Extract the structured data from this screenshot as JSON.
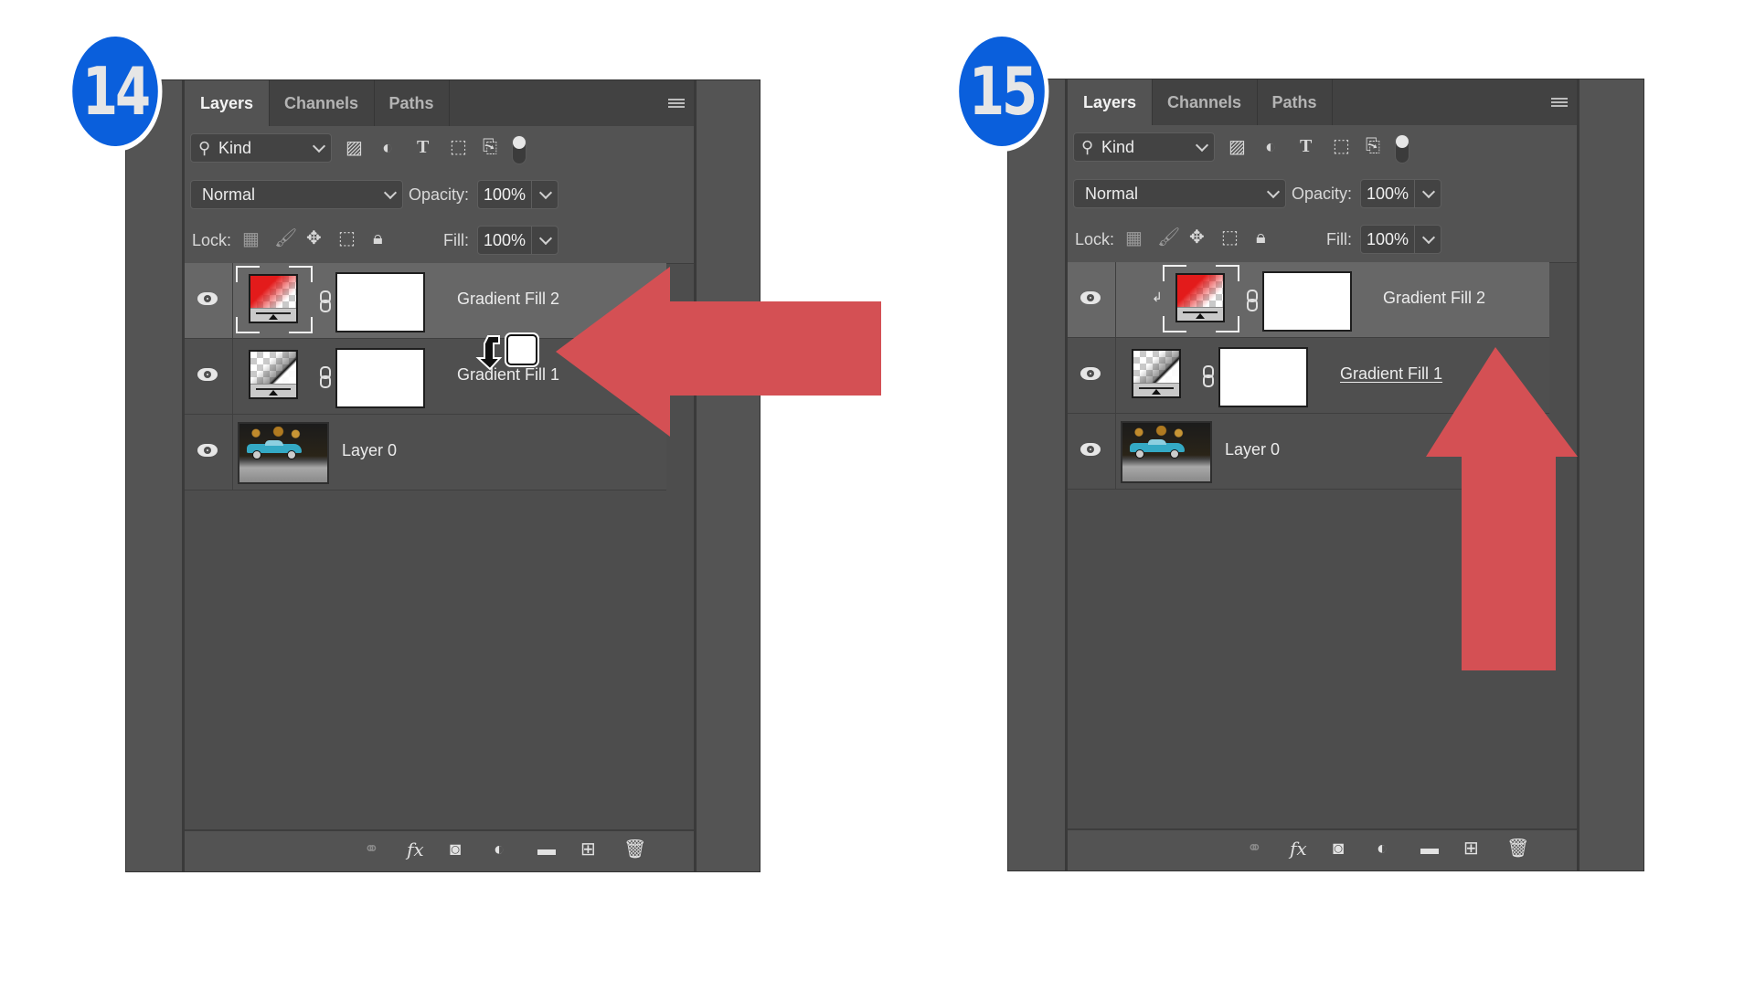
{
  "steps": [
    {
      "number": "14",
      "panel": {
        "tabs": [
          {
            "label": "Layers",
            "active": true
          },
          {
            "label": "Channels",
            "active": false
          },
          {
            "label": "Paths",
            "active": false
          }
        ],
        "filter": {
          "value": "Kind",
          "icons": [
            "image-filter-icon",
            "adjustment-filter-icon",
            "type-filter-icon",
            "shape-filter-icon",
            "smart-object-filter-icon",
            "filter-toggle"
          ]
        },
        "blend_mode": "Normal",
        "opacity_label": "Opacity:",
        "opacity_value": "100%",
        "lock_label": "Lock:",
        "fill_label": "Fill:",
        "fill_value": "100%",
        "layers": [
          {
            "name": "Gradient Fill 2",
            "type": "gradient",
            "thumb": "red",
            "selected": true,
            "clipped": false,
            "visible": true
          },
          {
            "name": "Gradient Fill 1",
            "type": "gradient",
            "thumb": "bw",
            "selected": false,
            "clipped": false,
            "visible": true,
            "underlined": false
          },
          {
            "name": "Layer 0",
            "type": "photo",
            "selected": false,
            "visible": true
          }
        ],
        "footer_icons": [
          "link-layers-icon",
          "fx-icon",
          "add-mask-icon",
          "adjustment-layer-icon",
          "group-folder-icon",
          "new-layer-icon",
          "trash-icon"
        ]
      },
      "annotation": {
        "type": "arrow-left",
        "color": "#d45054",
        "cursor": "clip-drag-cursor"
      }
    },
    {
      "number": "15",
      "panel": {
        "tabs": [
          {
            "label": "Layers",
            "active": true
          },
          {
            "label": "Channels",
            "active": false
          },
          {
            "label": "Paths",
            "active": false
          }
        ],
        "filter": {
          "value": "Kind"
        },
        "blend_mode": "Normal",
        "opacity_label": "Opacity:",
        "opacity_value": "100%",
        "lock_label": "Lock:",
        "fill_label": "Fill:",
        "fill_value": "100%",
        "layers": [
          {
            "name": "Gradient Fill 2",
            "type": "gradient",
            "thumb": "red",
            "selected": true,
            "clipped": true,
            "visible": true
          },
          {
            "name": "Gradient Fill 1",
            "type": "gradient",
            "thumb": "bw",
            "selected": false,
            "clipped": false,
            "visible": true,
            "underlined": true
          },
          {
            "name": "Layer 0",
            "type": "photo",
            "selected": false,
            "visible": true
          }
        ]
      },
      "annotation": {
        "type": "arrow-up",
        "color": "#d45054"
      }
    }
  ],
  "glyphs": {
    "fx": "fx",
    "clip_arrow": "↲",
    "plus": "+"
  }
}
